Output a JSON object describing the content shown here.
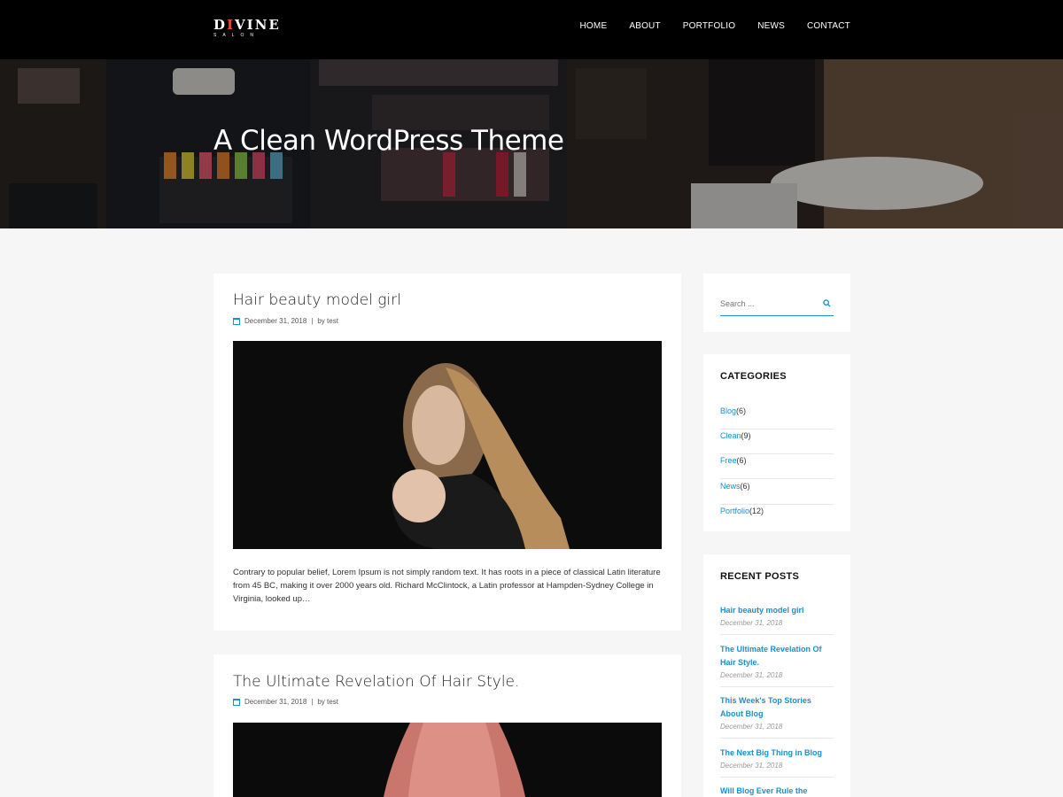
{
  "header": {
    "logo": {
      "prefix": "D",
      "accent": "I",
      "suffix": "VINE",
      "sub": "SALON"
    },
    "nav": [
      "HOME",
      "ABOUT",
      "PORTFOLIO",
      "NEWS",
      "CONTACT"
    ]
  },
  "hero": {
    "title": "A Clean WordPress Theme"
  },
  "posts": [
    {
      "title": "Hair beauty model girl",
      "date": "December 31, 2018",
      "separator": "|",
      "by": "by test",
      "excerpt": "Contrary to popular belief, Lorem Ipsum is not simply random text. It has roots in a piece of classical Latin literature from 45 BC, making it over 2000 years old. Richard McClintock, a Latin professor at Hampden-Sydney College in Virginia, looked up…"
    },
    {
      "title": "The Ultimate Revelation Of Hair Style.",
      "date": "December 31, 2018",
      "separator": "|",
      "by": "by test"
    }
  ],
  "sidebar": {
    "search": {
      "placeholder": "Search ..."
    },
    "categories": {
      "title": "CATEGORIES",
      "items": [
        {
          "name": "Blog",
          "count": "(6)"
        },
        {
          "name": "Clean",
          "count": "(9)"
        },
        {
          "name": "Free",
          "count": "(6)"
        },
        {
          "name": "News",
          "count": "(6)"
        },
        {
          "name": "Portfolio",
          "count": "(12)"
        }
      ]
    },
    "recent": {
      "title": "RECENT POSTS",
      "items": [
        {
          "title": "Hair beauty model girl",
          "date": "December 31, 2018"
        },
        {
          "title": "The Ultimate Revelation Of Hair Style.",
          "date": "December 31, 2018"
        },
        {
          "title": "This Week's Top Stories About Blog",
          "date": "December 31, 2018"
        },
        {
          "title": "The Next Big Thing in Blog",
          "date": "December 31, 2018"
        },
        {
          "title": "Will Blog Ever Rule the World?",
          "date": ""
        }
      ]
    }
  },
  "colors": {
    "accent": "#1a8fd1",
    "logo_accent": "#e0493b",
    "header_bg": "#000000",
    "page_bg": "#f6f6f6"
  }
}
